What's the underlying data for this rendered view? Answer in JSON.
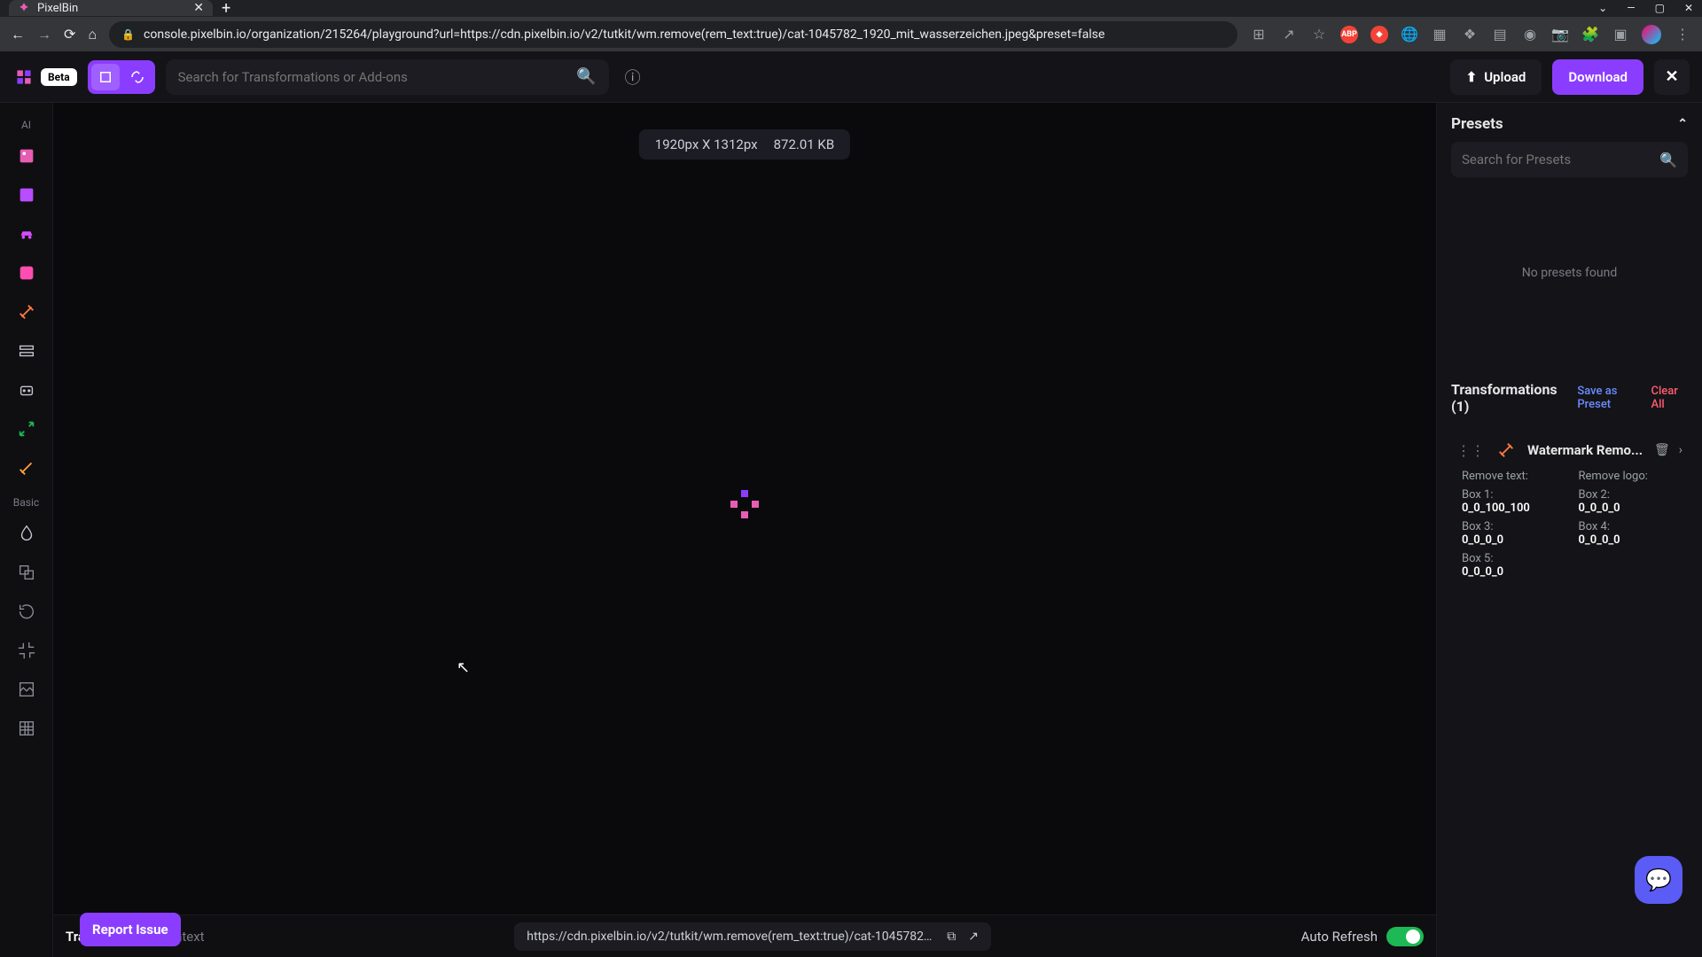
{
  "browser": {
    "tab_title": "PixelBin",
    "url": "console.pixelbin.io/organization/215264/playground?url=https://cdn.pixelbin.io/v2/tutkit/wm.remove(rem_text:true)/cat-1045782_1920_mit_wasserzeichen.jpeg&preset=false",
    "win_min": "—",
    "win_max": "▢",
    "win_close": "✕",
    "new_tab": "+",
    "tab_close": "✕"
  },
  "header": {
    "beta_label": "Beta",
    "search_placeholder": "Search for Transformations or Add-ons",
    "upload_label": "Upload",
    "download_label": "Download",
    "close_label": "✕"
  },
  "leftrail": {
    "label_ai": "AI",
    "label_basic": "Basic"
  },
  "canvas": {
    "dimensions": "1920px X 1312px",
    "filesize": "872.01 KB"
  },
  "bottombar": {
    "tabs": {
      "transformed": "Transformed",
      "context": "Context"
    },
    "url": "https://cdn.pixelbin.io/v2/tutkit/wm.remove(rem_text:true)/cat-1045782_1920_mit_...",
    "auto_refresh_label": "Auto Refresh",
    "report_issue": "Report Issue"
  },
  "rightpanel": {
    "presets_title": "Presets",
    "preset_search_placeholder": "Search for Presets",
    "no_presets": "No presets found",
    "transformations_title": "Transformations (1)",
    "save_as_preset": "Save as Preset",
    "clear_all": "Clear All",
    "card": {
      "name": "Watermark Remo...",
      "params": {
        "remove_text_label": "Remove text:",
        "remove_logo_label": "Remove logo:",
        "box1_label": "Box 1:",
        "box1_val": "0_0_100_100",
        "box2_label": "Box 2:",
        "box2_val": "0_0_0_0",
        "box3_label": "Box 3:",
        "box3_val": "0_0_0_0",
        "box4_label": "Box 4:",
        "box4_val": "0_0_0_0",
        "box5_label": "Box 5:",
        "box5_val": "0_0_0_0"
      }
    }
  },
  "ext": {
    "abp": "ABP"
  }
}
